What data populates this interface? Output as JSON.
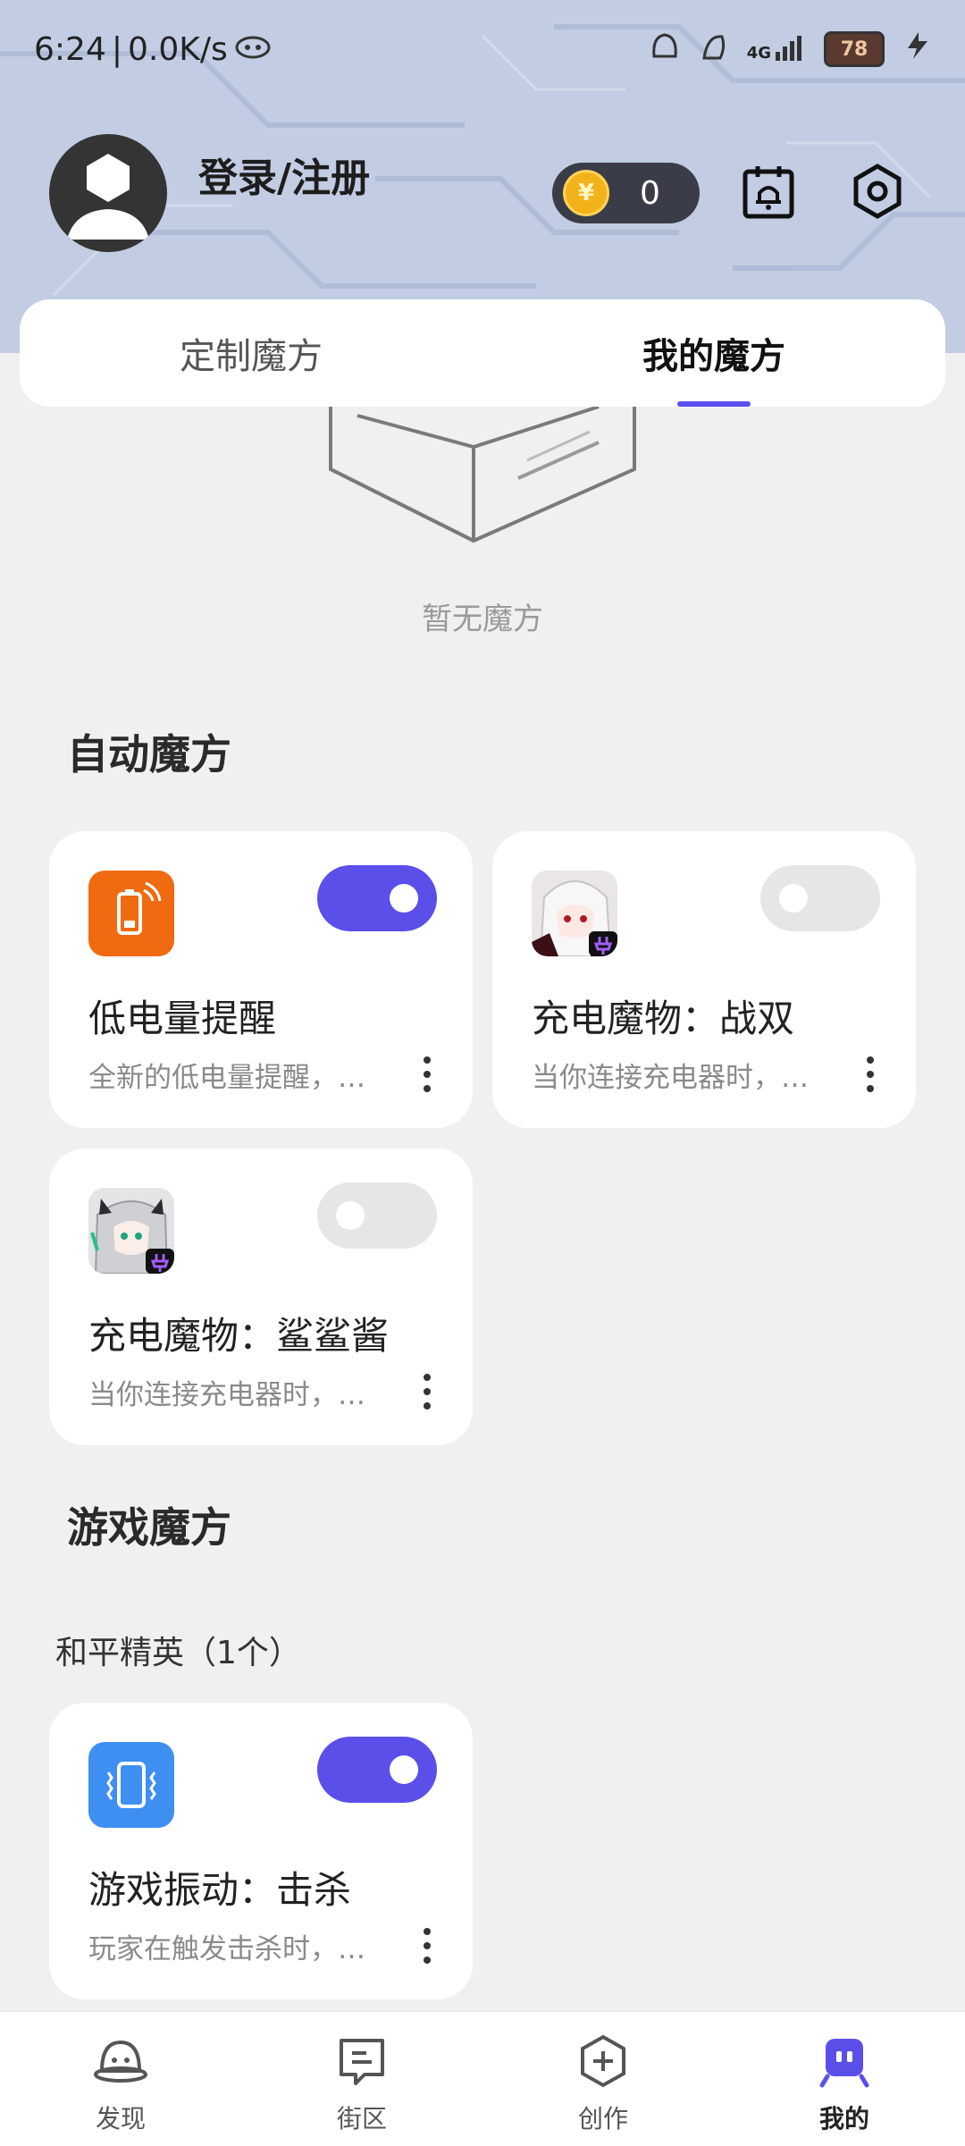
{
  "status_bar": {
    "time": "6:24",
    "speed": "0.0K/s",
    "network": "4G",
    "battery": "78"
  },
  "profile": {
    "login_label": "登录/注册",
    "coin_symbol": "¥",
    "coins": "0"
  },
  "tabs": [
    {
      "label": "定制魔方",
      "active": false
    },
    {
      "label": "我的魔方",
      "active": true
    }
  ],
  "empty_state": {
    "text": "暂无魔方"
  },
  "auto_section": {
    "title": "自动魔方",
    "cards": [
      {
        "title": "低电量提醒",
        "desc": "全新的低电量提醒，…",
        "enabled": true,
        "icon": "battery-icon"
      },
      {
        "title": "充电魔物：战双",
        "desc": "当你连接充电器时，…",
        "enabled": false,
        "icon": "anime-character-icon"
      },
      {
        "title": "充电魔物：鲨鲨酱",
        "desc": "当你连接充电器时，…",
        "enabled": false,
        "icon": "anime-character-icon"
      }
    ]
  },
  "game_section": {
    "title": "游戏魔方",
    "group_label": "和平精英（1个）",
    "cards": [
      {
        "title": "游戏振动：击杀",
        "desc": "玩家在触发击杀时，…",
        "enabled": true,
        "icon": "vibration-icon"
      }
    ]
  },
  "bottom_nav": [
    {
      "label": "发现",
      "icon": "discover-icon",
      "active": false
    },
    {
      "label": "街区",
      "icon": "chat-icon",
      "active": false
    },
    {
      "label": "创作",
      "icon": "create-icon",
      "active": false
    },
    {
      "label": "我的",
      "icon": "profile-icon",
      "active": true
    }
  ],
  "colors": {
    "accent": "#5b4fea",
    "header_bg": "#c2cde3",
    "page_bg": "#f0f0f0"
  }
}
